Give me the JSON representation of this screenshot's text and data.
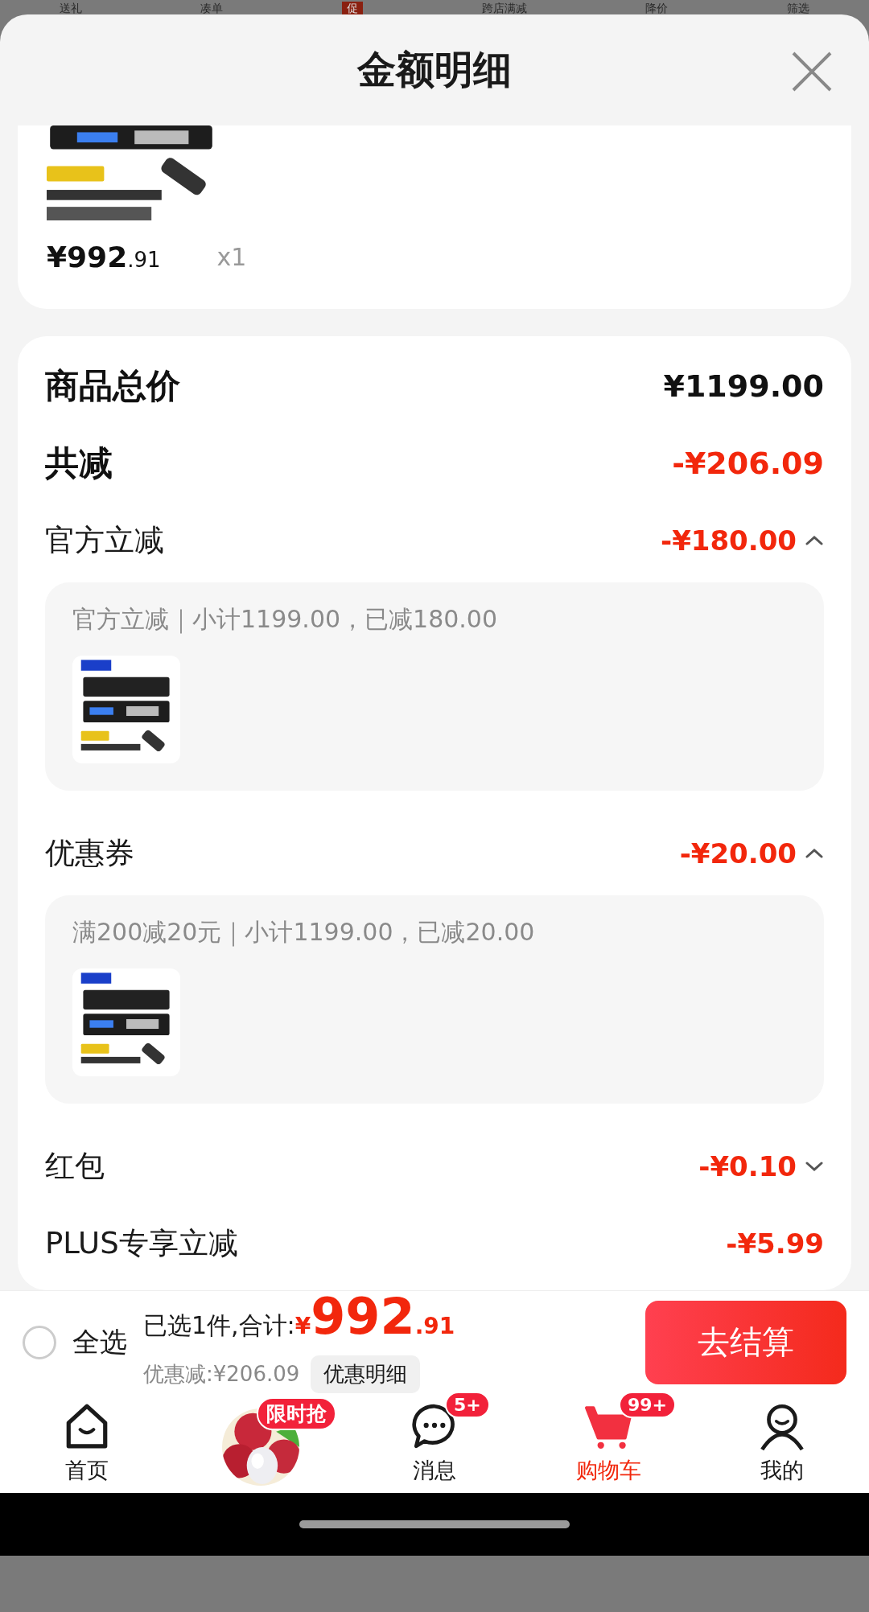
{
  "background_tabs": [
    {
      "label": "送礼",
      "kind": "text"
    },
    {
      "label": "凑单",
      "kind": "text"
    },
    {
      "label": "促",
      "kind": "tag"
    },
    {
      "label": "跨店满减",
      "kind": "text"
    },
    {
      "label": "降价",
      "kind": "text"
    },
    {
      "label": "筛选",
      "kind": "text"
    }
  ],
  "sheet": {
    "title": "金额明细"
  },
  "product": {
    "price_main": "¥992",
    "price_decimal": ".91",
    "quantity": "x1"
  },
  "summary": [
    {
      "label": "商品总价",
      "amount": "¥1199.00",
      "red": false
    },
    {
      "label": "共减",
      "amount": "-¥206.09",
      "red": true
    }
  ],
  "discounts": [
    {
      "label": "官方立减",
      "amount": "-¥180.00",
      "expanded": true,
      "detail": "官方立减｜小计1199.00，已减180.00"
    },
    {
      "label": "优惠券",
      "amount": "-¥20.00",
      "expanded": true,
      "detail": "满200减20元｜小计1199.00，已减20.00"
    },
    {
      "label": "红包",
      "amount": "-¥0.10",
      "expanded": false
    },
    {
      "label": "PLUS专享立减",
      "amount": "-¥5.99"
    }
  ],
  "checkout": {
    "select_all": {
      "label": "全选",
      "checked": false
    },
    "selected_text": "已选1件,合计:",
    "currency": "¥",
    "total_main": "992",
    "total_decimal": ".91",
    "discount_text": "优惠减:¥206.09",
    "detail_button": "优惠明细",
    "submit": "去结算"
  },
  "nav": [
    {
      "kind": "home",
      "label": "首页",
      "selected": false
    },
    {
      "kind": "promo",
      "badge": "限时抢",
      "selected": false
    },
    {
      "kind": "message",
      "label": "消息",
      "badge": "5+",
      "selected": false
    },
    {
      "kind": "cart",
      "label": "购物车",
      "badge": "99+",
      "selected": true
    },
    {
      "kind": "me",
      "label": "我的",
      "selected": false
    }
  ]
}
